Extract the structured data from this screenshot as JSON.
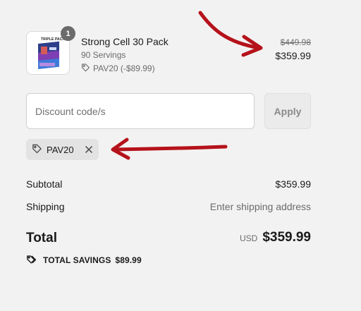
{
  "product": {
    "image_label": "TRIPLE PACK",
    "quantity": "1",
    "name": "Strong Cell 30 Pack",
    "variant": "90 Servings",
    "discount_line": "PAV20 (-$89.99)",
    "original_price": "$449.98",
    "price": "$359.99"
  },
  "discount": {
    "placeholder": "Discount code/s",
    "value": "",
    "apply_label": "Apply",
    "applied_code": "PAV20"
  },
  "summary": {
    "subtotal_label": "Subtotal",
    "subtotal_value": "$359.99",
    "shipping_label": "Shipping",
    "shipping_value": "Enter shipping address",
    "total_label": "Total",
    "currency": "USD",
    "total_value": "$359.99",
    "savings_label": "TOTAL SAVINGS",
    "savings_value": "$89.99"
  },
  "annotation": {
    "arrow_color": "#b5121b"
  },
  "icons": [
    "tag-icon",
    "close-icon",
    "tag-icon",
    "tags-icon"
  ]
}
